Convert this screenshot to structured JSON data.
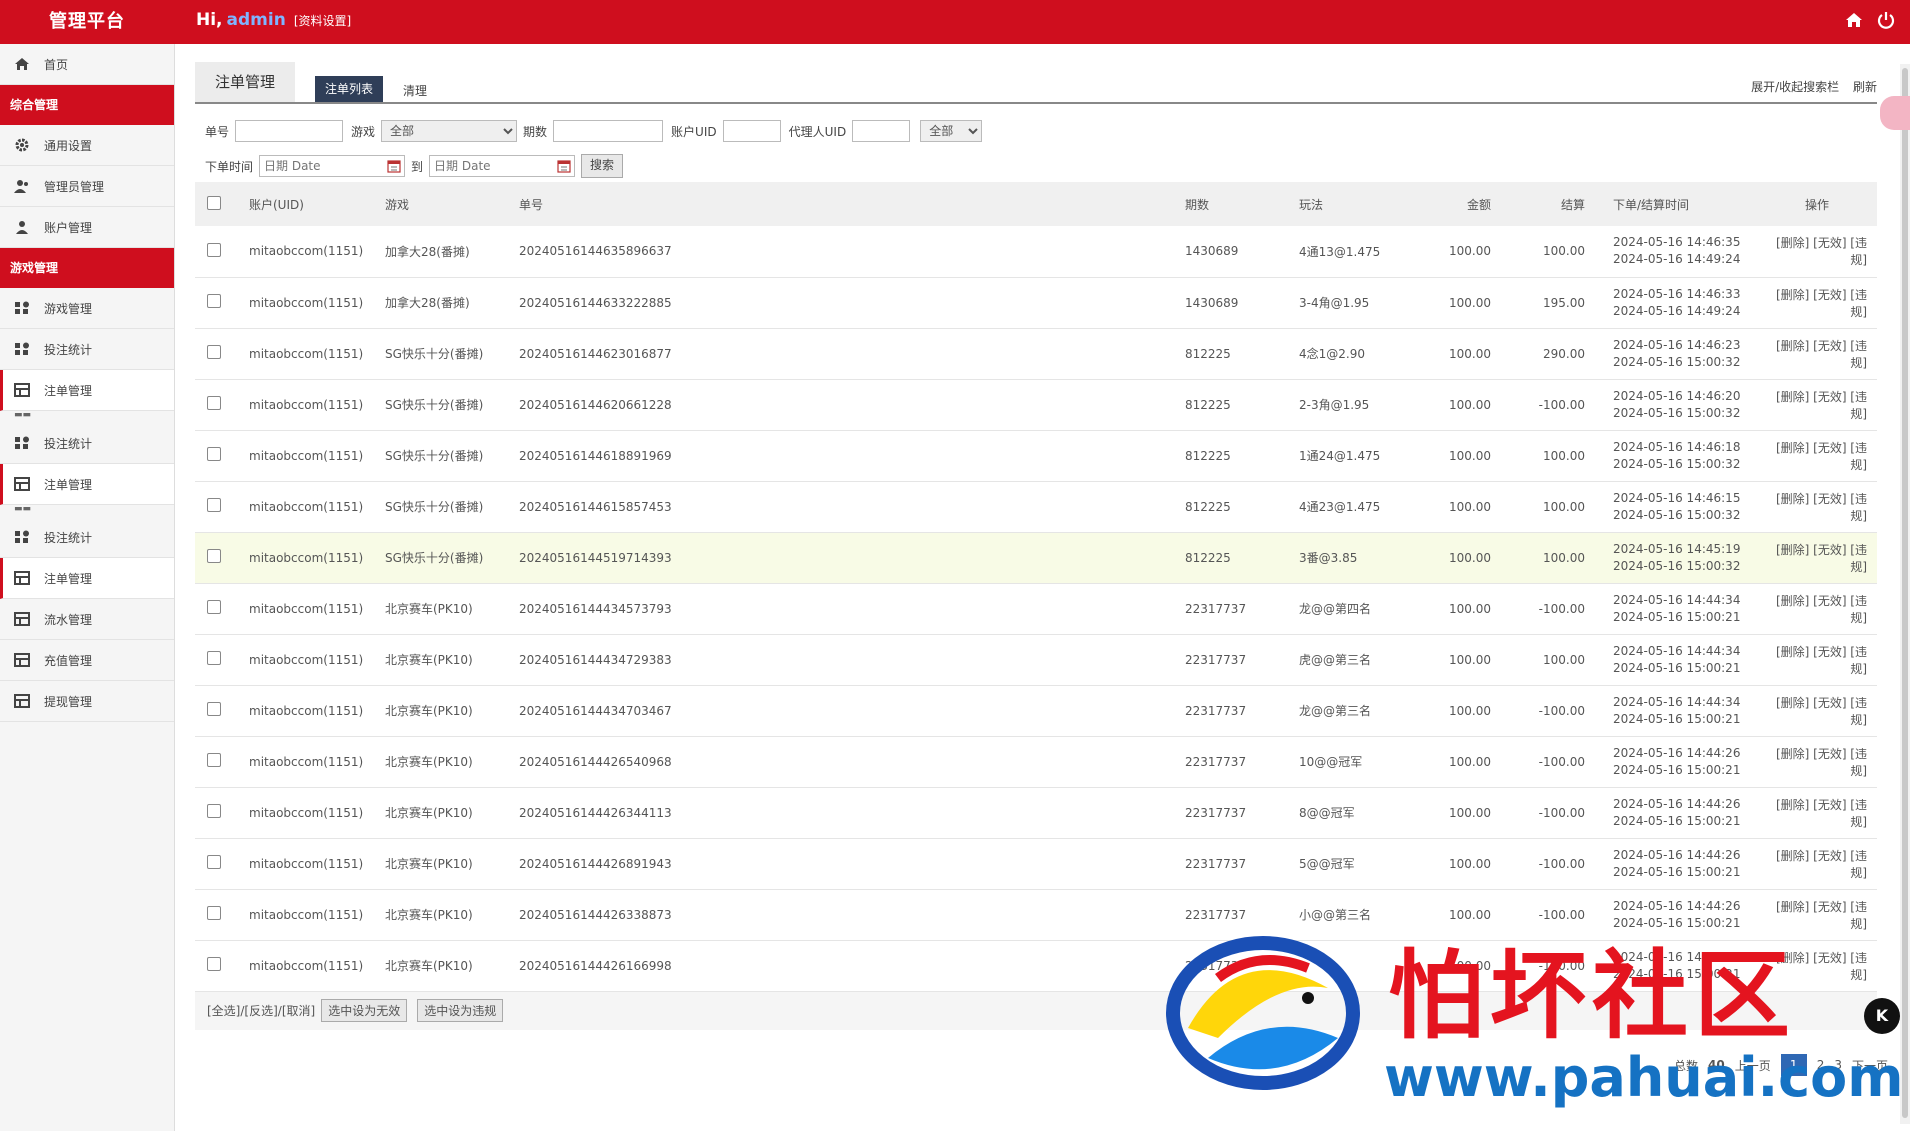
{
  "header": {
    "brand": "管理平台",
    "greeting": "Hi,",
    "username": "admin",
    "profile_link": "[资料设置]"
  },
  "sidebar": {
    "home": "首页",
    "group1": "综合管理",
    "group1_items": [
      "通用设置",
      "管理员管理",
      "账户管理"
    ],
    "group2": "游戏管理",
    "group2_items": [
      "游戏管理",
      "投注统计",
      "注单管理",
      "投注统计",
      "注单管理",
      "投注统计",
      "注单管理",
      "流水管理",
      "充值管理",
      "提现管理"
    ]
  },
  "tabs": {
    "title": "注单管理",
    "list": "注单列表",
    "clear": "清理",
    "toggle": "展开/收起搜索栏",
    "refresh": "刷新"
  },
  "filters": {
    "order_no": "单号",
    "game": "游戏",
    "game_value": "全部",
    "period": "期数",
    "account_uid": "账户UID",
    "agent_uid": "代理人UID",
    "status_value": "全部",
    "time_label": "下单时间",
    "date_placeholder": "日期 Date",
    "to": "到",
    "search": "搜索"
  },
  "table": {
    "headers": [
      "账户(UID)",
      "游戏",
      "单号",
      "期数",
      "玩法",
      "金额",
      "结算",
      "下单/结算时间",
      "操作"
    ],
    "ops": "[删除] [无效] [违规]",
    "rows": [
      {
        "account": "mitaobccom(1151)",
        "game": "加拿大28(番摊)",
        "order": "20240516144635896637",
        "period": "1430689",
        "play": "4通13@1.475",
        "amount": "100.00",
        "settle": "100.00",
        "t1": "2024-05-16 14:46:35",
        "t2": "2024-05-16 14:49:24"
      },
      {
        "account": "mitaobccom(1151)",
        "game": "加拿大28(番摊)",
        "order": "20240516144633222885",
        "period": "1430689",
        "play": "3-4角@1.95",
        "amount": "100.00",
        "settle": "195.00",
        "t1": "2024-05-16 14:46:33",
        "t2": "2024-05-16 14:49:24"
      },
      {
        "account": "mitaobccom(1151)",
        "game": "SG快乐十分(番摊)",
        "order": "20240516144623016877",
        "period": "812225",
        "play": "4念1@2.90",
        "amount": "100.00",
        "settle": "290.00",
        "t1": "2024-05-16 14:46:23",
        "t2": "2024-05-16 15:00:32"
      },
      {
        "account": "mitaobccom(1151)",
        "game": "SG快乐十分(番摊)",
        "order": "20240516144620661228",
        "period": "812225",
        "play": "2-3角@1.95",
        "amount": "100.00",
        "settle": "-100.00",
        "t1": "2024-05-16 14:46:20",
        "t2": "2024-05-16 15:00:32"
      },
      {
        "account": "mitaobccom(1151)",
        "game": "SG快乐十分(番摊)",
        "order": "20240516144618891969",
        "period": "812225",
        "play": "1通24@1.475",
        "amount": "100.00",
        "settle": "100.00",
        "t1": "2024-05-16 14:46:18",
        "t2": "2024-05-16 15:00:32"
      },
      {
        "account": "mitaobccom(1151)",
        "game": "SG快乐十分(番摊)",
        "order": "20240516144615857453",
        "period": "812225",
        "play": "4通23@1.475",
        "amount": "100.00",
        "settle": "100.00",
        "t1": "2024-05-16 14:46:15",
        "t2": "2024-05-16 15:00:32"
      },
      {
        "account": "mitaobccom(1151)",
        "game": "SG快乐十分(番摊)",
        "order": "20240516144519714393",
        "period": "812225",
        "play": "3番@3.85",
        "amount": "100.00",
        "settle": "100.00",
        "t1": "2024-05-16 14:45:19",
        "t2": "2024-05-16 15:00:32"
      },
      {
        "account": "mitaobccom(1151)",
        "game": "北京赛车(PK10)",
        "order": "20240516144434573793",
        "period": "22317737",
        "play": "龙@@第四名",
        "amount": "100.00",
        "settle": "-100.00",
        "t1": "2024-05-16 14:44:34",
        "t2": "2024-05-16 15:00:21"
      },
      {
        "account": "mitaobccom(1151)",
        "game": "北京赛车(PK10)",
        "order": "20240516144434729383",
        "period": "22317737",
        "play": "虎@@第三名",
        "amount": "100.00",
        "settle": "100.00",
        "t1": "2024-05-16 14:44:34",
        "t2": "2024-05-16 15:00:21"
      },
      {
        "account": "mitaobccom(1151)",
        "game": "北京赛车(PK10)",
        "order": "20240516144434703467",
        "period": "22317737",
        "play": "龙@@第三名",
        "amount": "100.00",
        "settle": "-100.00",
        "t1": "2024-05-16 14:44:34",
        "t2": "2024-05-16 15:00:21"
      },
      {
        "account": "mitaobccom(1151)",
        "game": "北京赛车(PK10)",
        "order": "20240516144426540968",
        "period": "22317737",
        "play": "10@@冠军",
        "amount": "100.00",
        "settle": "-100.00",
        "t1": "2024-05-16 14:44:26",
        "t2": "2024-05-16 15:00:21"
      },
      {
        "account": "mitaobccom(1151)",
        "game": "北京赛车(PK10)",
        "order": "20240516144426344113",
        "period": "22317737",
        "play": "8@@冠军",
        "amount": "100.00",
        "settle": "-100.00",
        "t1": "2024-05-16 14:44:26",
        "t2": "2024-05-16 15:00:21"
      },
      {
        "account": "mitaobccom(1151)",
        "game": "北京赛车(PK10)",
        "order": "20240516144426891943",
        "period": "22317737",
        "play": "5@@冠军",
        "amount": "100.00",
        "settle": "-100.00",
        "t1": "2024-05-16 14:44:26",
        "t2": "2024-05-16 15:00:21"
      },
      {
        "account": "mitaobccom(1151)",
        "game": "北京赛车(PK10)",
        "order": "20240516144426338873",
        "period": "22317737",
        "play": "小@@第三名",
        "amount": "100.00",
        "settle": "-100.00",
        "t1": "2024-05-16 14:44:26",
        "t2": "2024-05-16 15:00:21"
      },
      {
        "account": "mitaobccom(1151)",
        "game": "北京赛车(PK10)",
        "order": "20240516144426166998",
        "period": "22317737",
        "play": "",
        "amount": "100.00",
        "settle": "-100.00",
        "t1": "2024-05-16 14:44:26",
        "t2": "2024-05-16 15:00:21"
      }
    ]
  },
  "bulk": {
    "select": "[全选]/[反选]/[取消]",
    "invalid": "选中设为无效",
    "violation": "选中设为违规"
  },
  "pager": {
    "total_label": "总数",
    "total": "40",
    "prev": "上一页",
    "pages": [
      "1",
      "2",
      "3"
    ],
    "next": "下一页"
  },
  "watermark": {
    "text": "怕坏社区",
    "url": "www.pahuai.com"
  },
  "colors": {
    "primary": "#cf0e1e",
    "tab_active": "#2f3e58",
    "pager_active": "#2f68b4"
  }
}
